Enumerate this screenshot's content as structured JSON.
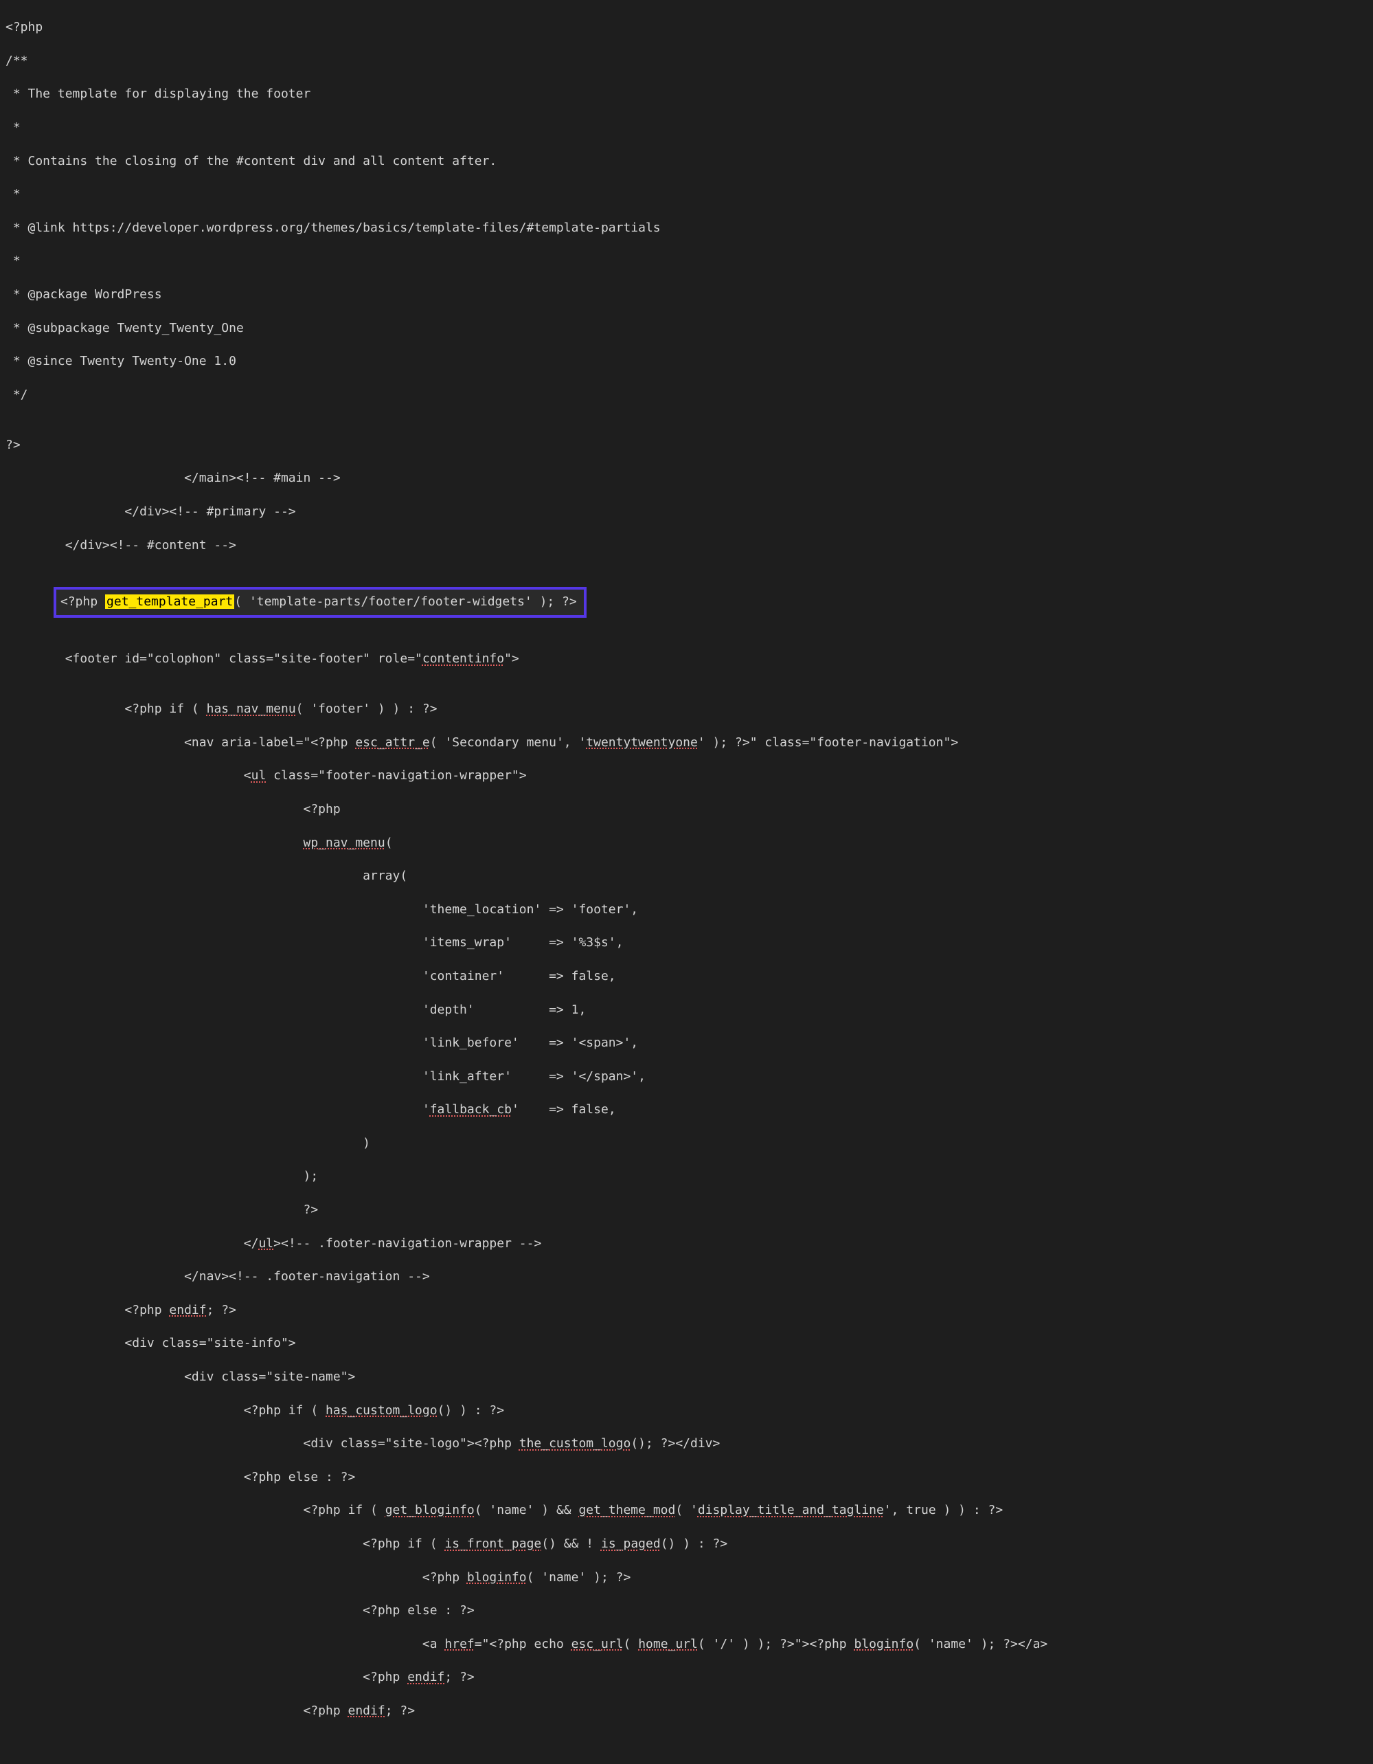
{
  "code": {
    "l01": "<?php",
    "l02": "/**",
    "l03": " * The template for displaying the footer",
    "l04": " *",
    "l05": " * Contains the closing of the #content div and all content after.",
    "l06": " *",
    "l07": " * @link https://developer.wordpress.org/themes/basics/template-files/#template-partials",
    "l08": " *",
    "l09": " * @package WordPress",
    "l10": " * @subpackage Twenty_Twenty_One",
    "l11": " * @since Twenty Twenty-One 1.0",
    "l12": " */",
    "l13": "",
    "l14": "?>",
    "l15a": "                        </main><!-- #main -->",
    "l16a": "                </div><!-- #primary -->",
    "l17a": "        </div><!-- #content -->",
    "l18": "",
    "hlPre": "<?php ",
    "hlHi": "get_template_part",
    "hlPost": "( 'template-parts/footer/footer-widgets' ); ?>",
    "l20": "",
    "l21a": "        <footer id=\"colophon\" class=\"site-footer\" role=\"",
    "l21b": "contentinfo",
    "l21c": "\">",
    "l22": "",
    "l23a": "                <?php if ( ",
    "l23b": "has_nav_menu",
    "l23c": "( 'footer' ) ) : ?>",
    "l24a": "                        <nav aria-label=\"<?php ",
    "l24b": "esc_attr_e",
    "l24c": "( 'Secondary menu', '",
    "l24d": "twentytwentyone",
    "l24e": "' ); ?>\" class=\"footer-navigation\">",
    "l25a": "                                <",
    "l25b": "ul",
    "l25c": " class=\"footer-navigation-wrapper\">",
    "l26": "                                        <?php",
    "l27a": "                                        ",
    "l27b": "wp_nav_menu",
    "l27c": "(",
    "l28": "                                                array(",
    "l29": "                                                        'theme_location' => 'footer',",
    "l30": "                                                        'items_wrap'     => '%3$s',",
    "l31": "                                                        'container'      => false,",
    "l32": "                                                        'depth'          => 1,",
    "l33": "                                                        'link_before'    => '<span>',",
    "l34": "                                                        'link_after'     => '</span>',",
    "l35a": "                                                        '",
    "l35b": "fallback_cb",
    "l35c": "'    => false,",
    "l36": "                                                )",
    "l37": "                                        );",
    "l38": "                                        ?>",
    "l39a": "                                </",
    "l39b": "ul",
    "l39c": "><!-- .footer-navigation-wrapper -->",
    "l40": "                        </nav><!-- .footer-navigation -->",
    "l41a": "                <?php ",
    "l41b": "endif",
    "l41c": "; ?>",
    "l42": "                <div class=\"site-info\">",
    "l43": "                        <div class=\"site-name\">",
    "l44a": "                                <?php if ( ",
    "l44b": "has_custom_logo",
    "l44c": "() ) : ?>",
    "l45a": "                                        <div class=\"site-logo\"><?php ",
    "l45b": "the_custom_logo",
    "l45c": "(); ?></div>",
    "l46": "                                <?php else : ?>",
    "l47a": "                                        <?php if ( ",
    "l47b": "get_bloginfo",
    "l47c": "( 'name' ) && ",
    "l47d": "get_theme_mod",
    "l47e": "( '",
    "l47f": "display_title_and_tagline",
    "l47g": "', true ) ) : ?>",
    "l48a": "                                                <?php if ( ",
    "l48b": "is_front_page",
    "l48c": "() && ! ",
    "l48d": "is_paged",
    "l48e": "() ) : ?>",
    "l49a": "                                                        <?php ",
    "l49b": "bloginfo",
    "l49c": "( 'name' ); ?>",
    "l50": "                                                <?php else : ?>",
    "l51a": "                                                        <a ",
    "l51b": "href",
    "l51c": "=\"<?php echo ",
    "l51d": "esc_url",
    "l51e": "( ",
    "l51f": "home_url",
    "l51g": "( '/' ) ); ?>\"><?php ",
    "l51h": "bloginfo",
    "l51i": "( 'name' ); ?></a>",
    "l52a": "                                                <?php ",
    "l52b": "endif",
    "l52c": "; ?>",
    "l53a": "                                        <?php ",
    "l53b": "endif",
    "l53c": "; ?>"
  }
}
